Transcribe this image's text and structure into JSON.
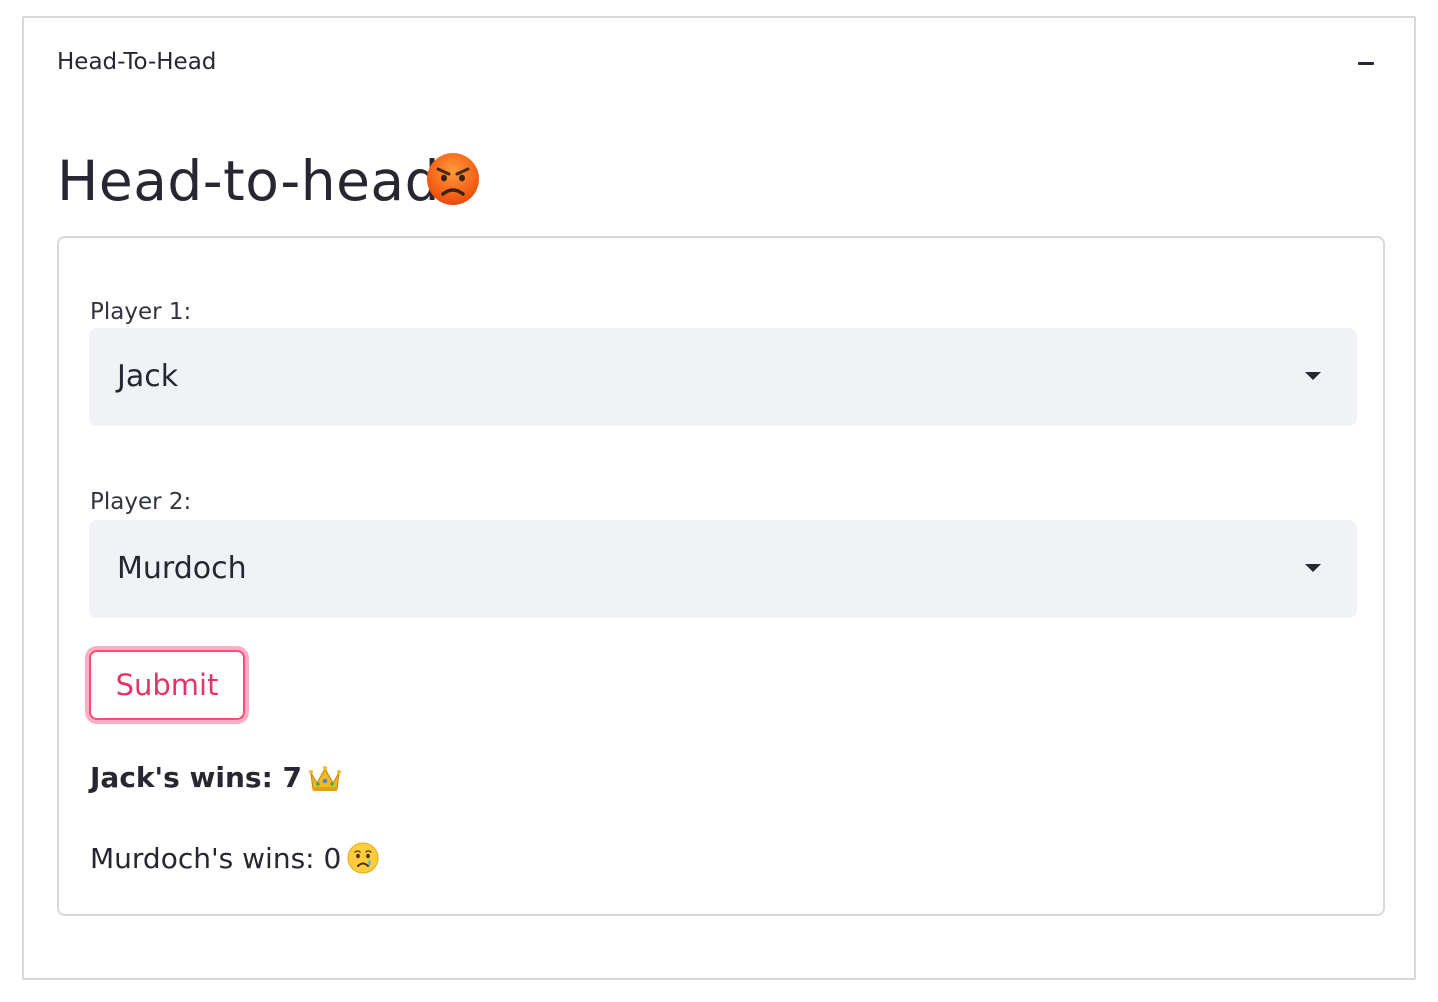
{
  "expander": {
    "title": "Head-To-Head",
    "collapse_icon": "minus-icon"
  },
  "page": {
    "title": "Head-to-head",
    "title_emoji": "angry-face-icon"
  },
  "form": {
    "player1": {
      "label": "Player 1:",
      "selected": "Jack"
    },
    "player2": {
      "label": "Player 2:",
      "selected": "Murdoch"
    },
    "submit_label": "Submit",
    "results": {
      "player1_wins": "Jack's wins: 7",
      "player1_icon": "crown-icon",
      "player2_wins": "Murdoch's wins: 0",
      "player2_icon": "crying-face-icon"
    }
  },
  "colors": {
    "accent": "#ff4b78",
    "select_bg": "#f0f2f6",
    "text": "#262730"
  }
}
